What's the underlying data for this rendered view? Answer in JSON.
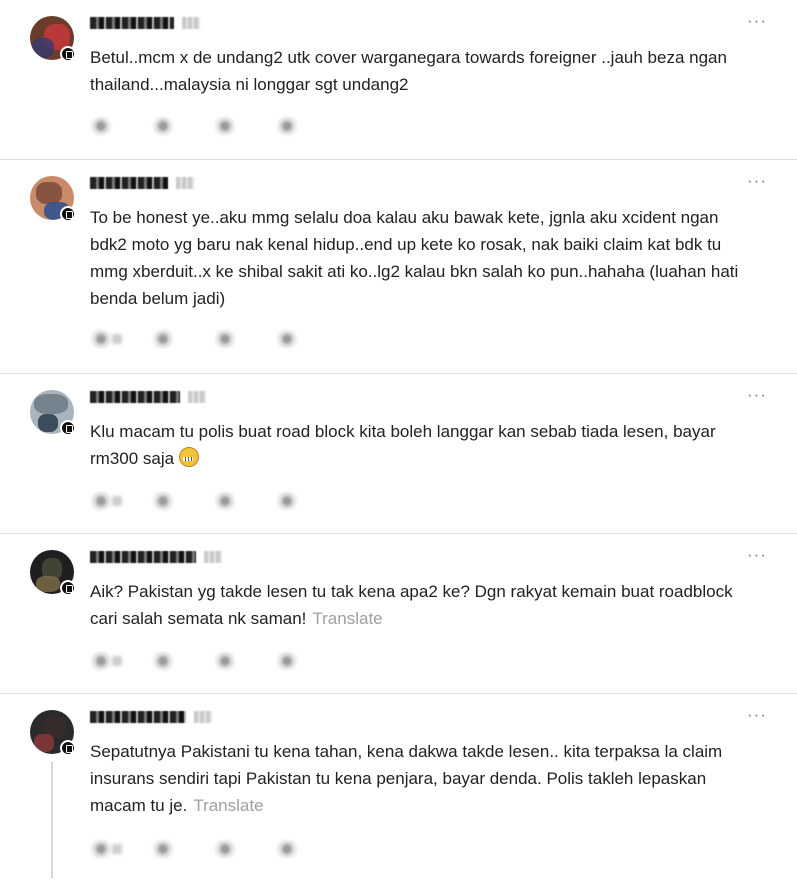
{
  "comments": [
    {
      "text": "Betul..mcm x de undang2 utk cover warganegara towards foreigner ..jauh beza ngan thailand...malaysia ni longgar sgt undang2",
      "translate": "",
      "avatar_colors": [
        "#6b3b2b",
        "#c53a3a",
        "#3a3a6b"
      ]
    },
    {
      "text": "To be honest ye..aku mmg selalu doa kalau aku bawak kete, jgnla aku xcident ngan bdk2 moto yg baru nak kenal hidup..end up kete ko rosak, nak baiki claim kat bdk tu mmg xberduit..x ke shibal sakit ati ko..lg2 kalau bkn salah ko pun..hahaha (luahan hati benda belum jadi)",
      "translate": "",
      "avatar_colors": [
        "#c98a6a",
        "#7a4a3a",
        "#2b4f8f"
      ]
    },
    {
      "text": "Klu macam tu polis buat road block kita boleh langgar kan sebab tiada lesen, bayar rm300 saja",
      "translate": "",
      "emoji": "grimacing-face",
      "avatar_colors": [
        "#6c7a86",
        "#aab4bd",
        "#2a3a4a"
      ]
    },
    {
      "text": "Aik? Pakistan yg takde lesen tu tak kena apa2 ke? Dgn rakyat kemain buat roadblock cari salah semata nk saman!",
      "translate": "Translate",
      "avatar_colors": [
        "#1f1f1f",
        "#4a4a3a",
        "#7a6a4a"
      ]
    },
    {
      "text": "Sepatutnya Pakistani tu kena tahan, kena dakwa takde lesen.. kita terpaksa la claim insurans sendiri tapi Pakistan tu kena penjara, bayar denda. Polis takleh lepaskan macam tu je.",
      "translate": "Translate",
      "avatar_colors": [
        "#3a2a2a",
        "#8a3a3a",
        "#2a2a2a"
      ]
    }
  ],
  "icons": {
    "more": "more-horizontal-icon",
    "like": "heart-icon",
    "reply": "comment-icon",
    "repost": "repost-icon",
    "share": "share-icon"
  },
  "colors": {
    "text": "#222222",
    "muted": "#a0a0a0",
    "divider": "#dcdcdc"
  }
}
